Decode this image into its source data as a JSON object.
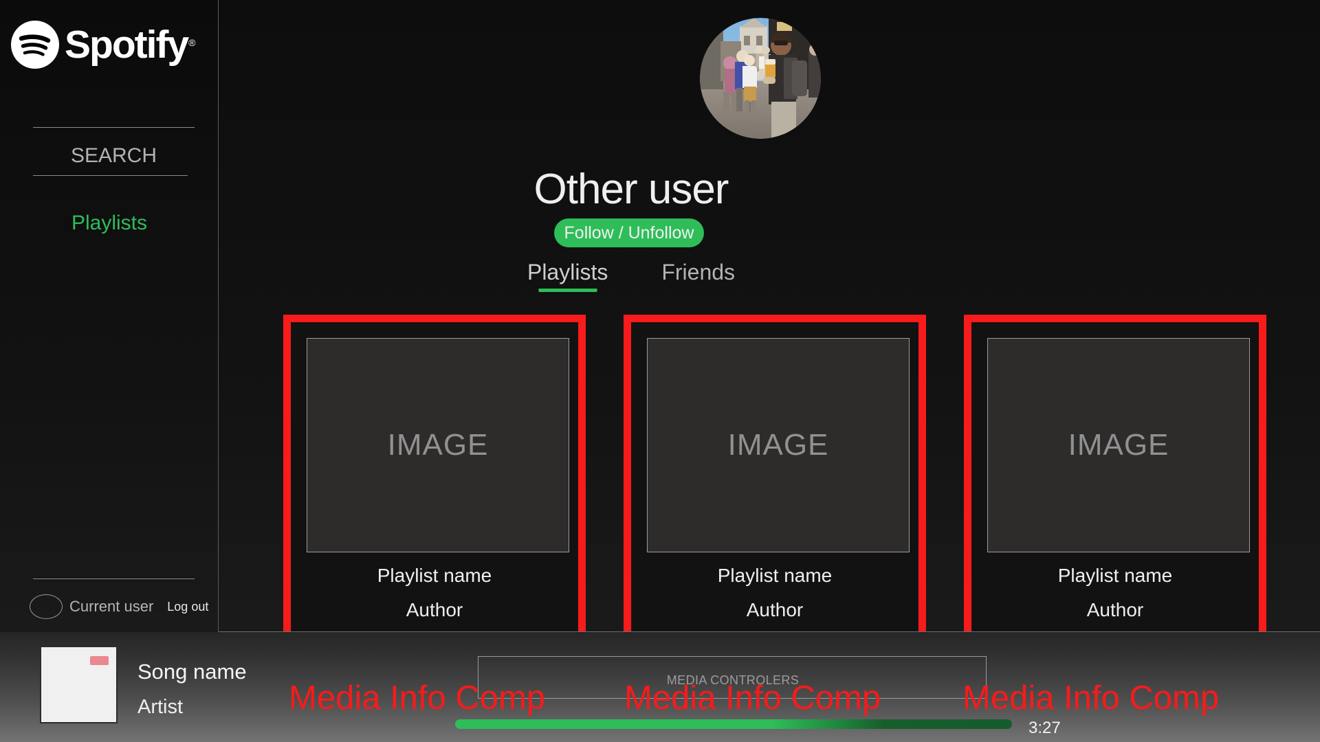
{
  "brand": {
    "name": "Spotify",
    "registered_mark": "®",
    "logo_icon": "spotify-logo-icon",
    "accent_green": "#2ebd59",
    "annotation_red": "#f71b1b"
  },
  "sidebar": {
    "search": {
      "placeholder": "SEARCH",
      "value": "",
      "icon": "search-field"
    },
    "nav": [
      {
        "label": "Playlists",
        "active": true
      }
    ],
    "current_user": {
      "avatar_icon": "avatar-placeholder-icon",
      "label": "Current user",
      "logout_label": "Log out"
    }
  },
  "profile": {
    "avatar_icon": "profile-photo-avatar",
    "name": "Other user",
    "follow_button_label": "Follow / Unfollow",
    "tabs": [
      {
        "label": "Playlists",
        "active": true
      },
      {
        "label": "Friends",
        "active": false
      }
    ]
  },
  "playlists": [
    {
      "image_placeholder": "IMAGE",
      "name": "Playlist name",
      "author": "Author"
    },
    {
      "image_placeholder": "IMAGE",
      "name": "Playlist name",
      "author": "Author"
    },
    {
      "image_placeholder": "IMAGE",
      "name": "Playlist name",
      "author": "Author"
    }
  ],
  "player": {
    "album_art_icon": "album-art-placeholder",
    "song_name": "Song name",
    "artist": "Artist",
    "controls_label": "MEDIA CONTROLERS",
    "progress_percent": 57,
    "duration": "3:27"
  },
  "annotations": [
    {
      "text": "Media Info Comp"
    },
    {
      "text": "Media Info Comp"
    },
    {
      "text": "Media Info Comp"
    }
  ]
}
